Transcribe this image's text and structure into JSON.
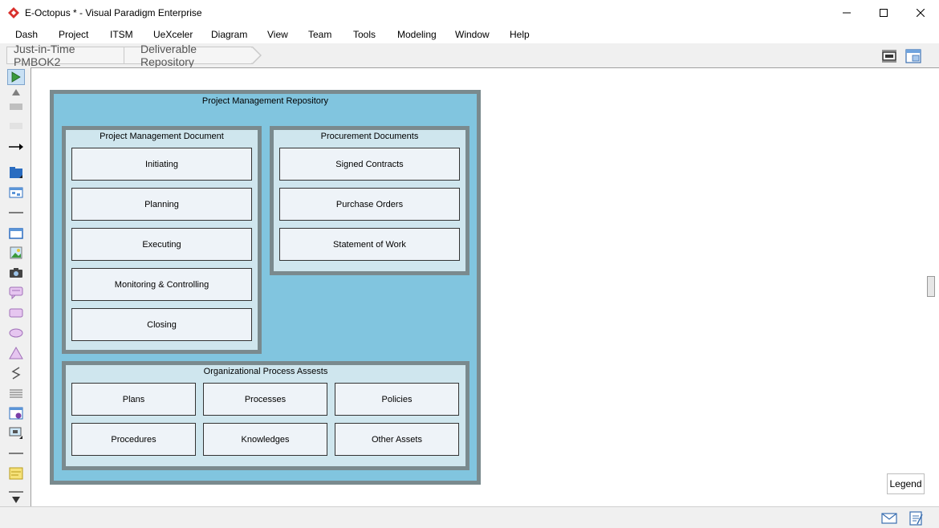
{
  "window": {
    "title": "E-Octopus * - Visual Paradigm Enterprise"
  },
  "menu": [
    "Dash",
    "Project",
    "ITSM",
    "UeXceler",
    "Diagram",
    "View",
    "Team",
    "Tools",
    "Modeling",
    "Window",
    "Help"
  ],
  "breadcrumb": [
    "Just-in-Time PMBOK2",
    "Deliverable Repository"
  ],
  "diagram": {
    "repository_title": "Project Management Repository",
    "pm_document": {
      "title": "Project Management Document",
      "items": [
        "Initiating",
        "Planning",
        "Executing",
        "Monitoring & Controlling",
        "Closing"
      ]
    },
    "procurement": {
      "title": "Procurement Documents",
      "items": [
        "Signed Contracts",
        "Purchase Orders",
        "Statement of Work"
      ]
    },
    "opa": {
      "title": "Organizational Process Assests",
      "items": [
        "Plans",
        "Processes",
        "Policies",
        "Procedures",
        "Knowledges",
        "Other Assets"
      ]
    }
  },
  "legend_label": "Legend",
  "colors": {
    "package_fill": "#81c5df",
    "inner_fill": "#cfe6ee",
    "border": "#7a8a8e",
    "box_fill": "#eef3f8",
    "app_red": "#d9302c"
  },
  "icons": {
    "app": "visual-paradigm-logo-icon",
    "minimize": "minimize-icon",
    "maximize": "maximize-icon",
    "close": "close-icon",
    "fit": "fit-diagram-icon",
    "diagram_nav": "diagram-navigator-icon",
    "mail": "mail-icon",
    "notes": "notes-icon"
  }
}
